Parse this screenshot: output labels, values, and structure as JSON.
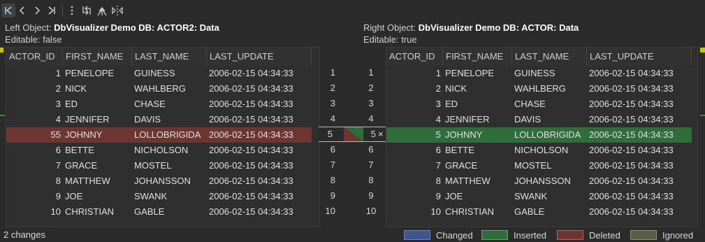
{
  "toolbar": {
    "first_icon": "first-diff-icon",
    "prev_icon": "prev-diff-icon",
    "next_icon": "next-diff-icon",
    "last_icon": "last-diff-icon",
    "menu_icon": "more-vert-icon",
    "swap_icon": "swap-icon",
    "merge_icon": "merge-icon",
    "split_icon": "split-view-icon"
  },
  "left": {
    "object_label": "Left Object:",
    "object_name": "DbVisualizer Demo DB: ACTOR2: Data",
    "editable": "Editable: false"
  },
  "right": {
    "object_label": "Right Object:",
    "object_name": "DbVisualizer Demo DB: ACTOR: Data",
    "editable": "Editable: true"
  },
  "columns": [
    "ACTOR_ID",
    "FIRST_NAME",
    "LAST_NAME",
    "LAST_UPDATE"
  ],
  "left_rows": [
    [
      "1",
      "PENELOPE",
      "GUINESS",
      "2006-02-15 04:34:33"
    ],
    [
      "2",
      "NICK",
      "WAHLBERG",
      "2006-02-15 04:34:33"
    ],
    [
      "3",
      "ED",
      "CHASE",
      "2006-02-15 04:34:33"
    ],
    [
      "4",
      "JENNIFER",
      "DAVIS",
      "2006-02-15 04:34:33"
    ],
    [
      "55",
      "JOHNNY",
      "LOLLOBRIGIDA",
      "2006-02-15 04:34:33"
    ],
    [
      "6",
      "BETTE",
      "NICHOLSON",
      "2006-02-15 04:34:33"
    ],
    [
      "7",
      "GRACE",
      "MOSTEL",
      "2006-02-15 04:34:33"
    ],
    [
      "8",
      "MATTHEW",
      "JOHANSSON",
      "2006-02-15 04:34:33"
    ],
    [
      "9",
      "JOE",
      "SWANK",
      "2006-02-15 04:34:33"
    ],
    [
      "10",
      "CHRISTIAN",
      "GABLE",
      "2006-02-15 04:34:33"
    ]
  ],
  "right_rows": [
    [
      "1",
      "PENELOPE",
      "GUINESS",
      "2006-02-15 04:34:33"
    ],
    [
      "2",
      "NICK",
      "WAHLBERG",
      "2006-02-15 04:34:33"
    ],
    [
      "3",
      "ED",
      "CHASE",
      "2006-02-15 04:34:33"
    ],
    [
      "4",
      "JENNIFER",
      "DAVIS",
      "2006-02-15 04:34:33"
    ],
    [
      "5",
      "JOHNNY",
      "LOLLOBRIGIDA",
      "2006-02-15 04:34:33"
    ],
    [
      "6",
      "BETTE",
      "NICHOLSON",
      "2006-02-15 04:34:33"
    ],
    [
      "7",
      "GRACE",
      "MOSTEL",
      "2006-02-15 04:34:33"
    ],
    [
      "8",
      "MATTHEW",
      "JOHANSSON",
      "2006-02-15 04:34:33"
    ],
    [
      "9",
      "JOE",
      "SWANK",
      "2006-02-15 04:34:33"
    ],
    [
      "10",
      "CHRISTIAN",
      "GABLE",
      "2006-02-15 04:34:33"
    ]
  ],
  "left_gutter": [
    "1",
    "2",
    "3",
    "4",
    "5",
    "6",
    "7",
    "8",
    "9",
    "10"
  ],
  "right_gutter": [
    "1",
    "2",
    "3",
    "4",
    "5",
    "6",
    "7",
    "8",
    "9",
    "10"
  ],
  "deleted_row_index": 4,
  "inserted_row_index": 4,
  "reject_glyph": "×",
  "status": "2 changes",
  "legend": [
    {
      "label": "Changed",
      "color": "#3e5590",
      "border": "#6d82c0"
    },
    {
      "label": "Inserted",
      "color": "#2f6d3a",
      "border": "#5fa86a"
    },
    {
      "label": "Deleted",
      "color": "#6e3531",
      "border": "#b06860"
    },
    {
      "label": "Ignored",
      "color": "#5a5e45",
      "border": "#8c9070"
    }
  ]
}
